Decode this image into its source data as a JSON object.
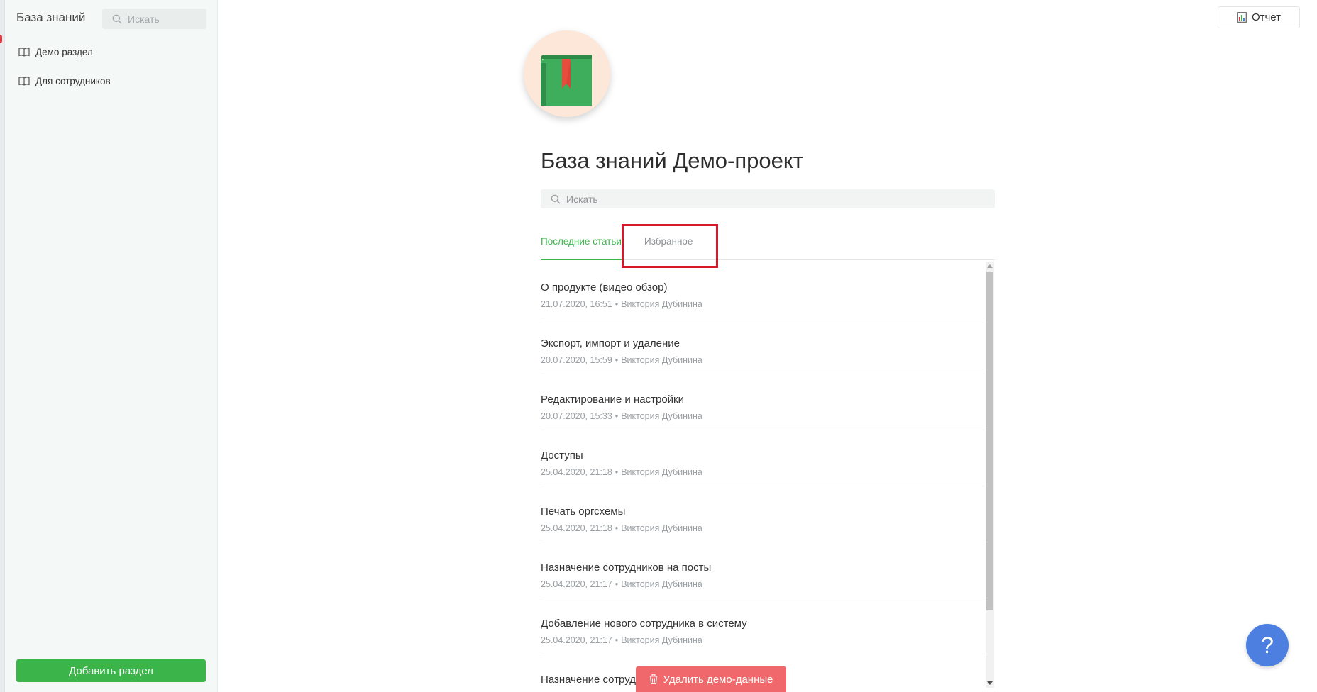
{
  "sidebar": {
    "title": "База знаний",
    "search_placeholder": "Искать",
    "items": [
      {
        "label": "Демо раздел",
        "icon": "book-open-icon"
      },
      {
        "label": "Для сотрудников",
        "icon": "book-open-icon"
      }
    ],
    "add_section_label": "Добавить раздел"
  },
  "header": {
    "report_label": "Отчет",
    "report_icon": "report-icon"
  },
  "main": {
    "title": "База знаний Демо-проект",
    "search_placeholder": "Искать",
    "tabs": [
      {
        "label": "Последние статьи",
        "active": true
      },
      {
        "label": "Избранное",
        "active": false
      }
    ],
    "articles": [
      {
        "title": "О продукте (видео обзор)",
        "date": "21.07.2020, 16:51",
        "author": "Виктория Дубинина"
      },
      {
        "title": "Экспорт, импорт и удаление",
        "date": "20.07.2020, 15:59",
        "author": "Виктория Дубинина"
      },
      {
        "title": "Редактирование и настройки",
        "date": "20.07.2020, 15:33",
        "author": "Виктория Дубинина"
      },
      {
        "title": "Доступы",
        "date": "25.04.2020, 21:18",
        "author": "Виктория Дубинина"
      },
      {
        "title": "Печать оргсхемы",
        "date": "25.04.2020, 21:18",
        "author": "Виктория Дубинина"
      },
      {
        "title": "Назначение сотрудников на посты",
        "date": "25.04.2020, 21:17",
        "author": "Виктория Дубинина"
      },
      {
        "title": "Добавление нового сотрудника в систему",
        "date": "25.04.2020, 21:17",
        "author": "Виктория Дубинина"
      },
      {
        "title": "Назначение сотруд",
        "date": "",
        "author": ""
      }
    ],
    "meta_separator": "•"
  },
  "footer": {
    "delete_demo_label": "Удалить демо-данные",
    "help_label": "?"
  },
  "colors": {
    "accent": "#3bb54a",
    "danger": "#f0686b",
    "help": "#4c7fe0",
    "highlight": "#d6182a"
  }
}
